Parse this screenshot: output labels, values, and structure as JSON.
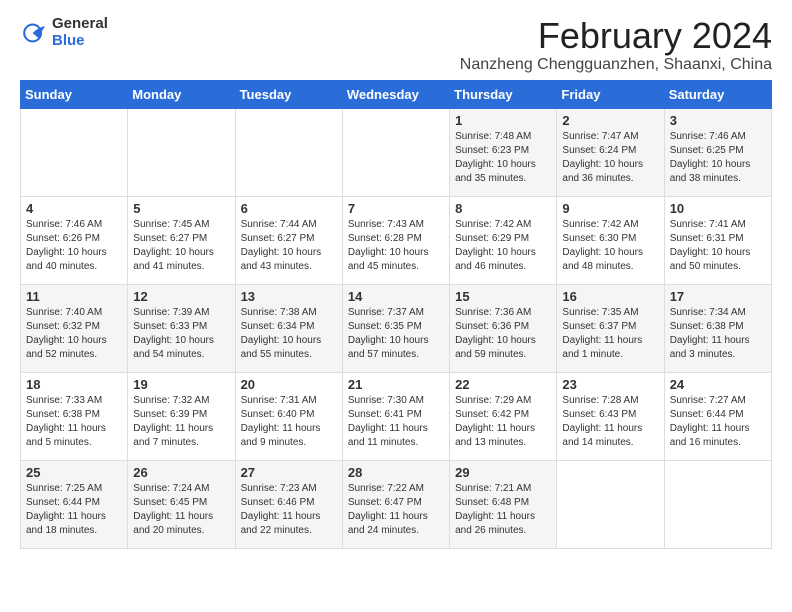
{
  "logo": {
    "general": "General",
    "blue": "Blue"
  },
  "title": "February 2024",
  "location": "Nanzheng Chengguanzhen, Shaanxi, China",
  "weekdays": [
    "Sunday",
    "Monday",
    "Tuesday",
    "Wednesday",
    "Thursday",
    "Friday",
    "Saturday"
  ],
  "weeks": [
    [
      {
        "day": "",
        "info": ""
      },
      {
        "day": "",
        "info": ""
      },
      {
        "day": "",
        "info": ""
      },
      {
        "day": "",
        "info": ""
      },
      {
        "day": "1",
        "info": "Sunrise: 7:48 AM\nSunset: 6:23 PM\nDaylight: 10 hours\nand 35 minutes."
      },
      {
        "day": "2",
        "info": "Sunrise: 7:47 AM\nSunset: 6:24 PM\nDaylight: 10 hours\nand 36 minutes."
      },
      {
        "day": "3",
        "info": "Sunrise: 7:46 AM\nSunset: 6:25 PM\nDaylight: 10 hours\nand 38 minutes."
      }
    ],
    [
      {
        "day": "4",
        "info": "Sunrise: 7:46 AM\nSunset: 6:26 PM\nDaylight: 10 hours\nand 40 minutes."
      },
      {
        "day": "5",
        "info": "Sunrise: 7:45 AM\nSunset: 6:27 PM\nDaylight: 10 hours\nand 41 minutes."
      },
      {
        "day": "6",
        "info": "Sunrise: 7:44 AM\nSunset: 6:27 PM\nDaylight: 10 hours\nand 43 minutes."
      },
      {
        "day": "7",
        "info": "Sunrise: 7:43 AM\nSunset: 6:28 PM\nDaylight: 10 hours\nand 45 minutes."
      },
      {
        "day": "8",
        "info": "Sunrise: 7:42 AM\nSunset: 6:29 PM\nDaylight: 10 hours\nand 46 minutes."
      },
      {
        "day": "9",
        "info": "Sunrise: 7:42 AM\nSunset: 6:30 PM\nDaylight: 10 hours\nand 48 minutes."
      },
      {
        "day": "10",
        "info": "Sunrise: 7:41 AM\nSunset: 6:31 PM\nDaylight: 10 hours\nand 50 minutes."
      }
    ],
    [
      {
        "day": "11",
        "info": "Sunrise: 7:40 AM\nSunset: 6:32 PM\nDaylight: 10 hours\nand 52 minutes."
      },
      {
        "day": "12",
        "info": "Sunrise: 7:39 AM\nSunset: 6:33 PM\nDaylight: 10 hours\nand 54 minutes."
      },
      {
        "day": "13",
        "info": "Sunrise: 7:38 AM\nSunset: 6:34 PM\nDaylight: 10 hours\nand 55 minutes."
      },
      {
        "day": "14",
        "info": "Sunrise: 7:37 AM\nSunset: 6:35 PM\nDaylight: 10 hours\nand 57 minutes."
      },
      {
        "day": "15",
        "info": "Sunrise: 7:36 AM\nSunset: 6:36 PM\nDaylight: 10 hours\nand 59 minutes."
      },
      {
        "day": "16",
        "info": "Sunrise: 7:35 AM\nSunset: 6:37 PM\nDaylight: 11 hours\nand 1 minute."
      },
      {
        "day": "17",
        "info": "Sunrise: 7:34 AM\nSunset: 6:38 PM\nDaylight: 11 hours\nand 3 minutes."
      }
    ],
    [
      {
        "day": "18",
        "info": "Sunrise: 7:33 AM\nSunset: 6:38 PM\nDaylight: 11 hours\nand 5 minutes."
      },
      {
        "day": "19",
        "info": "Sunrise: 7:32 AM\nSunset: 6:39 PM\nDaylight: 11 hours\nand 7 minutes."
      },
      {
        "day": "20",
        "info": "Sunrise: 7:31 AM\nSunset: 6:40 PM\nDaylight: 11 hours\nand 9 minutes."
      },
      {
        "day": "21",
        "info": "Sunrise: 7:30 AM\nSunset: 6:41 PM\nDaylight: 11 hours\nand 11 minutes."
      },
      {
        "day": "22",
        "info": "Sunrise: 7:29 AM\nSunset: 6:42 PM\nDaylight: 11 hours\nand 13 minutes."
      },
      {
        "day": "23",
        "info": "Sunrise: 7:28 AM\nSunset: 6:43 PM\nDaylight: 11 hours\nand 14 minutes."
      },
      {
        "day": "24",
        "info": "Sunrise: 7:27 AM\nSunset: 6:44 PM\nDaylight: 11 hours\nand 16 minutes."
      }
    ],
    [
      {
        "day": "25",
        "info": "Sunrise: 7:25 AM\nSunset: 6:44 PM\nDaylight: 11 hours\nand 18 minutes."
      },
      {
        "day": "26",
        "info": "Sunrise: 7:24 AM\nSunset: 6:45 PM\nDaylight: 11 hours\nand 20 minutes."
      },
      {
        "day": "27",
        "info": "Sunrise: 7:23 AM\nSunset: 6:46 PM\nDaylight: 11 hours\nand 22 minutes."
      },
      {
        "day": "28",
        "info": "Sunrise: 7:22 AM\nSunset: 6:47 PM\nDaylight: 11 hours\nand 24 minutes."
      },
      {
        "day": "29",
        "info": "Sunrise: 7:21 AM\nSunset: 6:48 PM\nDaylight: 11 hours\nand 26 minutes."
      },
      {
        "day": "",
        "info": ""
      },
      {
        "day": "",
        "info": ""
      }
    ]
  ]
}
